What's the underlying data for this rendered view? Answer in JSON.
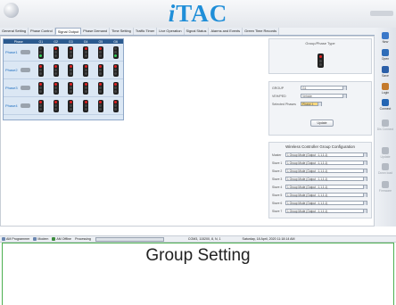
{
  "app": {
    "title_i": "i",
    "title_rest": "TAC"
  },
  "tabs": [
    "General Setting",
    "Phase Control",
    "Signal Output",
    "Phase Demand",
    "Time Setting",
    "Traffic Timer",
    "Live Operation",
    "Signal Status",
    "Alarms and Events",
    "Green Time Records"
  ],
  "phase_table": {
    "header": {
      "phase": "Phase",
      "groups": [
        "G1",
        "G2",
        "G3",
        "G4",
        "G5",
        "G6"
      ]
    },
    "rows": [
      {
        "label": "Phase1",
        "lights": [
          "green",
          "red",
          "red",
          "red",
          "red",
          "green"
        ]
      },
      {
        "label": "Phase2",
        "lights": [
          "red",
          "red",
          "red",
          "red",
          "red",
          "red"
        ]
      },
      {
        "label": "Phase3",
        "lights": [
          "red",
          "red",
          "red",
          "red",
          "red",
          "red"
        ]
      },
      {
        "label": "Phase4",
        "lights": [
          "red",
          "red",
          "red",
          "red",
          "red",
          "red"
        ]
      }
    ]
  },
  "group_phase": {
    "title": "Group/Phase Type"
  },
  "form": {
    "group_label": "GROUP",
    "group_value": "G1",
    "vehped_label": "VEH/PED",
    "vehped_value": "Vehicle",
    "selected_label": "Selected Phases",
    "selected_value": "Phase 1",
    "update_label": "Update"
  },
  "wireless": {
    "title": "Wireless Controller Group Configuration",
    "rows": [
      {
        "label": "Master",
        "value": "1 Group Mode (Output : 1,1,1,1)"
      },
      {
        "label": "Slave 1",
        "value": "1 Group Mode (Output : 1,1,1,1)"
      },
      {
        "label": "Slave 2",
        "value": "1 Group Mode (Output : 1,1,1,1)"
      },
      {
        "label": "Slave 3",
        "value": "1 Group Mode (Output : 1,1,1,1)"
      },
      {
        "label": "Slave 4",
        "value": "1 Group Mode (Output : 1,1,1,1)"
      },
      {
        "label": "Slave 5",
        "value": "1 Group Mode (Output : 1,1,1,1)"
      },
      {
        "label": "Slave 6",
        "value": "1 Group Mode (Output : 1,1,1,1)"
      },
      {
        "label": "Slave 7",
        "value": "1 Group Mode (Output : 1,1,1,1)"
      }
    ]
  },
  "sidebar": [
    {
      "label": "New",
      "icon": "new-icon",
      "color": "#3a78c9",
      "enabled": true
    },
    {
      "label": "Open",
      "icon": "folder-icon",
      "color": "#2f6db8",
      "enabled": true
    },
    {
      "label": "Save",
      "icon": "save-icon",
      "color": "#2b5fa8",
      "enabled": true
    },
    {
      "label": "Login",
      "icon": "user-icon",
      "color": "#c47a2c",
      "enabled": true
    },
    {
      "label": "Connect",
      "icon": "connect-icon",
      "color": "#2566b3",
      "enabled": true
    },
    {
      "label": "Dis Connect",
      "icon": "disconnect-icon",
      "color": "#b4bac3",
      "enabled": false
    },
    {
      "label": "Update",
      "icon": "update-icon",
      "color": "#b4bac3",
      "enabled": false
    },
    {
      "label": "Down load",
      "icon": "download-icon",
      "color": "#b4bac3",
      "enabled": false
    },
    {
      "label": "Firmware",
      "icon": "firmware-icon",
      "color": "#b4bac3",
      "enabled": false
    }
  ],
  "status": {
    "programmer": "AM Programmer",
    "modem": "Modem",
    "offline": "AM Offline",
    "processing": "Processing",
    "progress": 0,
    "port": "COM3, 115200, 8, N, 1",
    "datetime": "Saturday, 18 April, 2020    11:18:14 AM"
  },
  "caption": "Group Setting"
}
